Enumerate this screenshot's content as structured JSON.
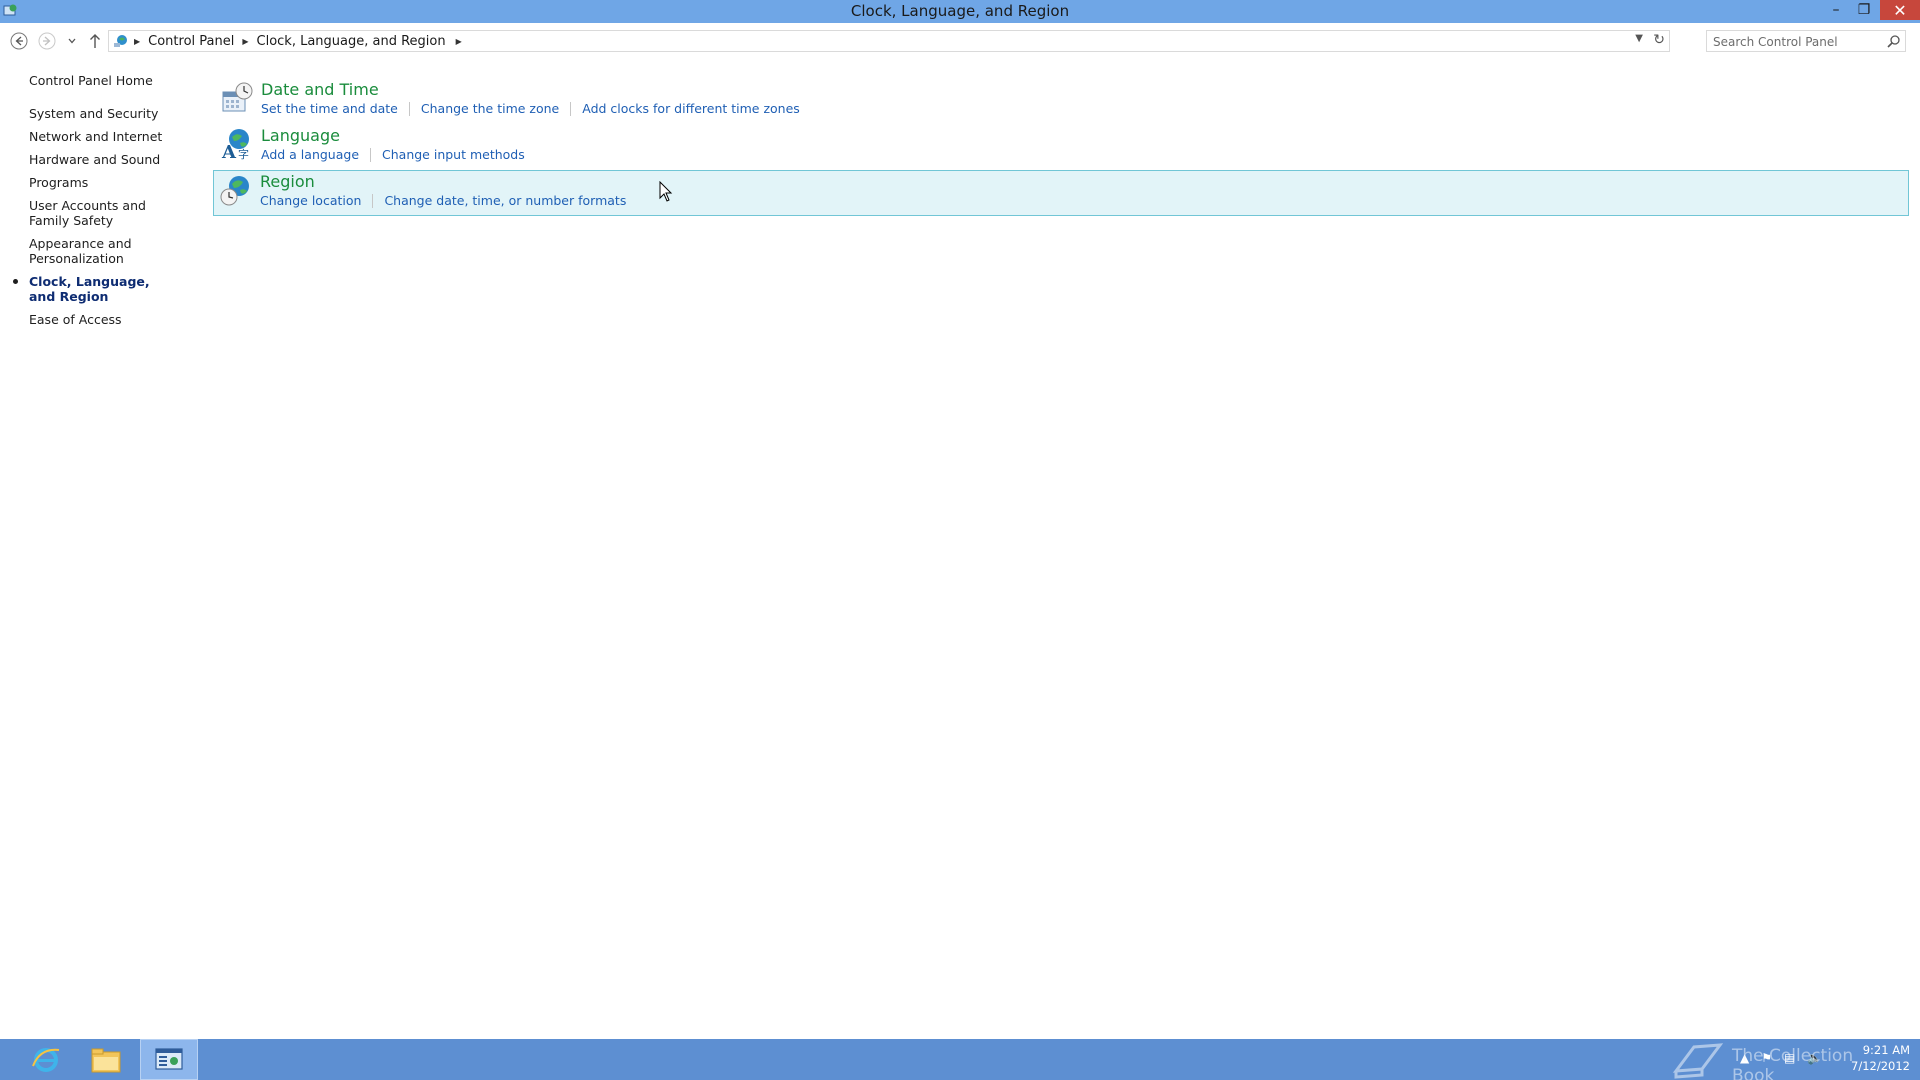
{
  "window": {
    "title": "Clock, Language, and Region",
    "minimize_glyph": "–",
    "maximize_glyph": "❐",
    "close_glyph": "✕"
  },
  "navigation": {
    "breadcrumbs": [
      "Control Panel",
      "Clock, Language, and Region"
    ],
    "search_placeholder": "Search Control Panel"
  },
  "sidebar": {
    "home": "Control Panel Home",
    "items": [
      {
        "label": "System and Security"
      },
      {
        "label": "Network and Internet"
      },
      {
        "label": "Hardware and Sound"
      },
      {
        "label": "Programs"
      },
      {
        "label": "User Accounts and Family Safety"
      },
      {
        "label": "Appearance and Personalization"
      },
      {
        "label": "Clock, Language, and Region",
        "active": true
      },
      {
        "label": "Ease of Access"
      }
    ]
  },
  "categories": [
    {
      "title": "Date and Time",
      "icon": "date-time-icon",
      "links": [
        "Set the time and date",
        "Change the time zone",
        "Add clocks for different time zones"
      ]
    },
    {
      "title": "Language",
      "icon": "language-icon",
      "links": [
        "Add a language",
        "Change input methods"
      ]
    },
    {
      "title": "Region",
      "icon": "region-globe-icon",
      "links": [
        "Change location",
        "Change date, time, or number formats"
      ],
      "hovered": true
    }
  ],
  "taskbar": {
    "apps": [
      "internet-explorer-icon",
      "file-explorer-icon",
      "control-panel-icon"
    ],
    "active_app": "control-panel-icon",
    "time": "9:21 AM",
    "date": "7/12/2012",
    "watermark": "The Collection Book"
  },
  "colors": {
    "titlebar": "#6fa6e6",
    "taskbar": "#5d8fd2",
    "category_title": "#1a8c3c",
    "link": "#1f5fb4",
    "hover_bg": "#e2f4f8",
    "hover_border": "#71c6d6",
    "close_button": "#c7473c"
  }
}
